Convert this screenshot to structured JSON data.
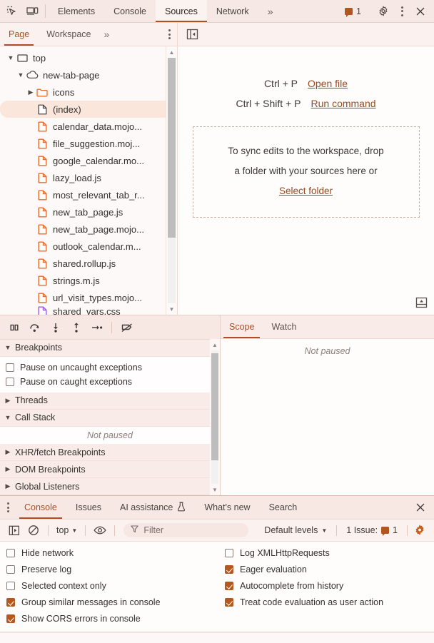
{
  "topbar": {
    "icons": [
      {
        "name": "inspect-element-icon"
      },
      {
        "name": "device-toolbar-icon"
      }
    ],
    "tabs": [
      {
        "label": "Elements",
        "selected": false
      },
      {
        "label": "Console",
        "selected": false
      },
      {
        "label": "Sources",
        "selected": true
      },
      {
        "label": "Network",
        "selected": false
      }
    ],
    "more_label": "»",
    "issue_count": "1",
    "settings_label": "Settings",
    "more_options_label": "More options",
    "close_label": "Close"
  },
  "navigator_tabs": {
    "tabs": [
      {
        "label": "Page",
        "selected": true
      },
      {
        "label": "Workspace",
        "selected": false
      }
    ],
    "more_label": "»",
    "panel_toggle_name": "show-navigator-icon"
  },
  "file_tree": [
    {
      "label": "top",
      "indent": 0,
      "arrow": "▼",
      "icon": "frame-icon",
      "selected": false
    },
    {
      "label": "new-tab-page",
      "indent": 1,
      "arrow": "▼",
      "icon": "cloud-icon",
      "selected": false
    },
    {
      "label": "icons",
      "indent": 2,
      "arrow": "▶",
      "icon": "folder-icon",
      "selected": false
    },
    {
      "label": "(index)",
      "indent": 3,
      "arrow": "",
      "icon": "document-icon",
      "selected": true
    },
    {
      "label": "calendar_data.mojo...",
      "indent": 3,
      "arrow": "",
      "icon": "script-icon",
      "selected": false
    },
    {
      "label": "file_suggestion.moj...",
      "indent": 3,
      "arrow": "",
      "icon": "script-icon",
      "selected": false
    },
    {
      "label": "google_calendar.mo...",
      "indent": 3,
      "arrow": "",
      "icon": "script-icon",
      "selected": false
    },
    {
      "label": "lazy_load.js",
      "indent": 3,
      "arrow": "",
      "icon": "script-icon",
      "selected": false
    },
    {
      "label": "most_relevant_tab_r...",
      "indent": 3,
      "arrow": "",
      "icon": "script-icon",
      "selected": false
    },
    {
      "label": "new_tab_page.js",
      "indent": 3,
      "arrow": "",
      "icon": "script-icon",
      "selected": false
    },
    {
      "label": "new_tab_page.mojo...",
      "indent": 3,
      "arrow": "",
      "icon": "script-icon",
      "selected": false
    },
    {
      "label": "outlook_calendar.m...",
      "indent": 3,
      "arrow": "",
      "icon": "script-icon",
      "selected": false
    },
    {
      "label": "shared.rollup.js",
      "indent": 3,
      "arrow": "",
      "icon": "script-icon",
      "selected": false
    },
    {
      "label": "strings.m.js",
      "indent": 3,
      "arrow": "",
      "icon": "script-icon",
      "selected": false
    },
    {
      "label": "url_visit_types.mojo...",
      "indent": 3,
      "arrow": "",
      "icon": "script-icon",
      "selected": false
    },
    {
      "label": "shared_vars.css",
      "indent": 3,
      "arrow": "",
      "icon": "stylesheet-icon",
      "selected": false
    }
  ],
  "editor": {
    "shortcuts": [
      {
        "keys": "Ctrl + P",
        "action": "Open file"
      },
      {
        "keys": "Ctrl + Shift + P",
        "action": "Run command"
      }
    ],
    "dropzone_line1": "To sync edits to the workspace, drop",
    "dropzone_line2": "a folder with your sources here or",
    "dropzone_link": "Select folder",
    "bottom_toggle_name": "toggle-drawer-icon"
  },
  "debugger": {
    "toolbar": [
      {
        "name": "pause-script-execution-icon",
        "label": "Pause script execution"
      },
      {
        "name": "step-over-icon",
        "label": "Step over next function call"
      },
      {
        "name": "step-into-icon",
        "label": "Step into next function call"
      },
      {
        "name": "step-out-icon",
        "label": "Step out of current function"
      },
      {
        "name": "step-icon",
        "label": "Step"
      },
      {
        "name": "deactivate-breakpoints-icon",
        "label": "Deactivate breakpoints"
      }
    ],
    "sections": [
      {
        "label": "Breakpoints",
        "expanded": true
      },
      {
        "label": "Threads",
        "expanded": false
      },
      {
        "label": "Call Stack",
        "expanded": true
      },
      {
        "label": "XHR/fetch Breakpoints",
        "expanded": false
      },
      {
        "label": "DOM Breakpoints",
        "expanded": false
      },
      {
        "label": "Global Listeners",
        "expanded": false
      }
    ],
    "breakpoint_options": [
      {
        "label": "Pause on uncaught exceptions",
        "checked": false
      },
      {
        "label": "Pause on caught exceptions",
        "checked": false
      }
    ],
    "call_stack_empty": "Not paused"
  },
  "scope_panel": {
    "tabs": [
      {
        "label": "Scope",
        "selected": true
      },
      {
        "label": "Watch",
        "selected": false
      }
    ],
    "empty_text": "Not paused"
  },
  "drawer": {
    "tabs": [
      {
        "label": "Console",
        "selected": true,
        "icon": null
      },
      {
        "label": "Issues",
        "selected": false,
        "icon": null
      },
      {
        "label": "AI assistance",
        "selected": false,
        "icon": "flask-icon"
      },
      {
        "label": "What's new",
        "selected": false,
        "icon": null
      },
      {
        "label": "Search",
        "selected": false,
        "icon": null
      }
    ],
    "close_label": "×",
    "console_toolbar": {
      "sidebar_toggle_name": "console-sidebar-icon",
      "clear_console_name": "clear-console-icon",
      "context_value": "top",
      "eye_name": "live-expression-icon",
      "filter_placeholder": "Filter",
      "filter_value": "",
      "levels_value": "Default levels",
      "issue_text": "1 Issue:",
      "issue_count": "1",
      "settings_name": "console-settings-gear-icon"
    },
    "settings_left": [
      {
        "label": "Hide network",
        "checked": false
      },
      {
        "label": "Preserve log",
        "checked": false
      },
      {
        "label": "Selected context only",
        "checked": false
      },
      {
        "label": "Group similar messages in console",
        "checked": true
      },
      {
        "label": "Show CORS errors in console",
        "checked": true
      }
    ],
    "settings_right": [
      {
        "label": "Log XMLHttpRequests",
        "checked": false
      },
      {
        "label": "Eager evaluation",
        "checked": true
      },
      {
        "label": "Autocomplete from history",
        "checked": true
      },
      {
        "label": "Treat code evaluation as user action",
        "checked": true
      }
    ]
  },
  "colors": {
    "accent": "#a9502a",
    "panel_bg": "#f7e8e3",
    "content_bg": "#fffdfc",
    "selection": "#fbe6dc",
    "checkbox_checked": "#b5581f",
    "script_icon": "#f06a28",
    "stylesheet_icon": "#9b5de5"
  }
}
